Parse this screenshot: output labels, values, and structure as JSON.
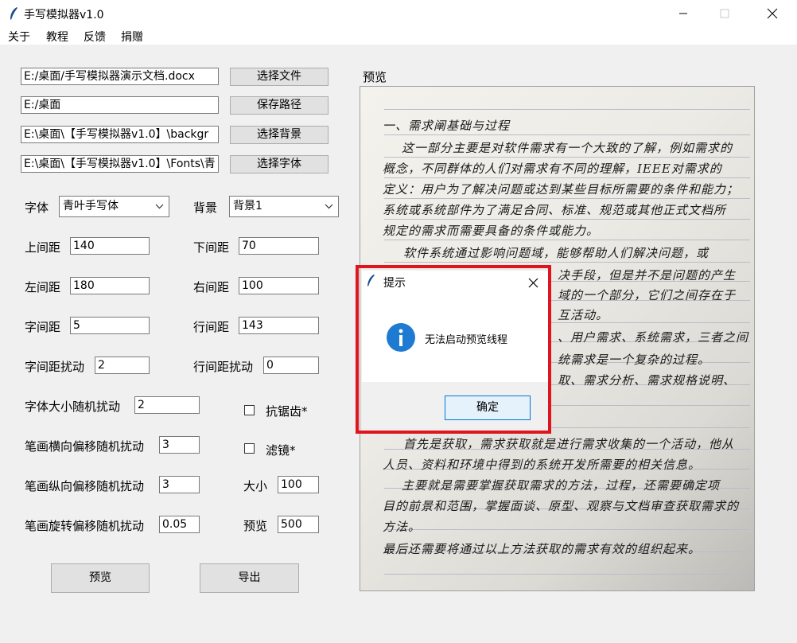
{
  "window": {
    "title": "手写模拟器v1.0",
    "menu": [
      "关于",
      "教程",
      "反馈",
      "捐赠"
    ]
  },
  "files": [
    {
      "value": "E:/桌面/手写模拟器演示文档.docx",
      "button": "选择文件"
    },
    {
      "value": "E:/桌面",
      "button": "保存路径"
    },
    {
      "value": "E:\\桌面\\【手写模拟器v1.0】\\backgr",
      "button": "选择背景"
    },
    {
      "value": "E:\\桌面\\【手写模拟器v1.0】\\Fonts\\青",
      "button": "选择字体"
    }
  ],
  "font": {
    "label": "字体",
    "value": "青叶手写体"
  },
  "background": {
    "label": "背景",
    "value": "背景1"
  },
  "params": {
    "top_margin": {
      "label": "上间距",
      "value": "140"
    },
    "bottom_margin": {
      "label": "下间距",
      "value": "70"
    },
    "left_margin": {
      "label": "左间距",
      "value": "180"
    },
    "right_margin": {
      "label": "右间距",
      "value": "100"
    },
    "char_spacing": {
      "label": "字间距",
      "value": "5"
    },
    "line_spacing": {
      "label": "行间距",
      "value": "143"
    },
    "char_spacing_jitter": {
      "label": "字间距扰动",
      "value": "2"
    },
    "line_spacing_jitter": {
      "label": "行间距扰动",
      "value": "0"
    },
    "font_size_jitter": {
      "label": "字体大小随机扰动",
      "value": "2"
    },
    "stroke_h_jitter": {
      "label": "笔画横向偏移随机扰动",
      "value": "3"
    },
    "stroke_v_jitter": {
      "label": "笔画纵向偏移随机扰动",
      "value": "3"
    },
    "stroke_rot_jitter": {
      "label": "笔画旋转偏移随机扰动",
      "value": "0.05"
    },
    "size": {
      "label": "大小",
      "value": "100"
    },
    "preview_count": {
      "label": "预览",
      "value": "500"
    }
  },
  "options": {
    "antialias": {
      "label": "抗锯齿*",
      "checked": false
    },
    "filter": {
      "label": "滤镜*",
      "checked": false
    }
  },
  "actions": {
    "preview": "预览",
    "export": "导出"
  },
  "preview_label": "预览",
  "preview_text": [
    "一、需求阐基础与过程",
    "这一部分主要是对软件需求有一个大致的了解，例如需求的",
    "概念，不同群体的人们对需求有不同的理解，IEEE对需求的",
    "定义：用户为了解决问题或达到某些目标所需要的条件和能力；",
    "系统或系统部件为了满足合同、标准、规范或其他正式文档所",
    "规定的需求而需要具备的条件或能力。",
    "软件系统通过影响问题域，能够帮助人们解决问题，或",
    "决手段，但是并不是问题的产生",
    "域的一个部分，它们之间存在于",
    "互活动。",
    "、用户需求、系统需求，三者之间",
    "统需求是一个复杂的过程。",
    "取、需求分析、需求规格说明、",
    "",
    "首先是获取，需求获取就是进行需求收集的一个活动，他从",
    "人员、资料和环境中得到的系统开发所需要的相关信息。",
    "主要就是需要掌握获取需求的方法，过程，还需要确定项",
    "目的前景和范围，掌握面谈、原型、观察与文档审查获取需求的",
    "方法。",
    "最后还需要将通过以上方法获取的需求有效的组织起来。"
  ],
  "dialog": {
    "title": "提示",
    "message": "无法启动预览线程",
    "ok": "确定"
  }
}
